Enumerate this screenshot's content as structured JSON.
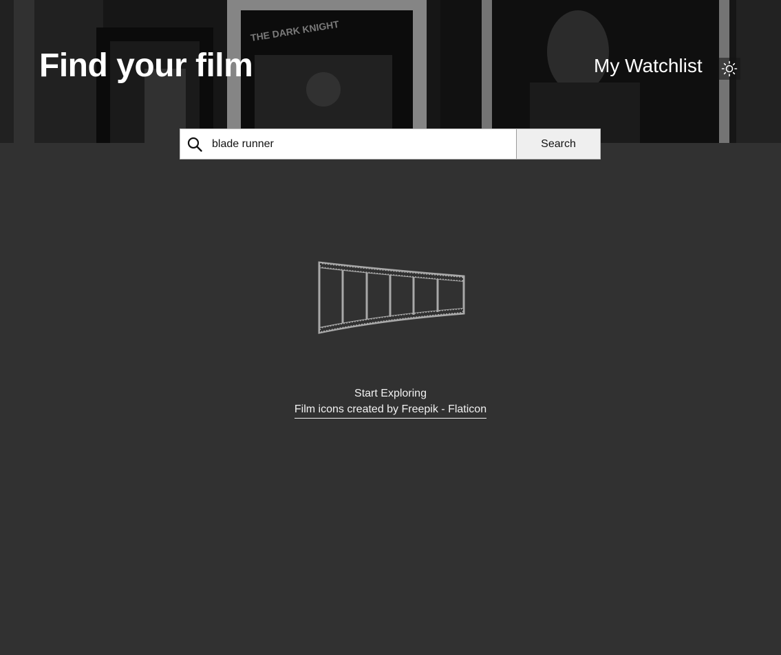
{
  "header": {
    "title": "Find your film",
    "watchlist_label": "My Watchlist",
    "theme_toggle_icon": "sun-icon",
    "background_poster_text": "THE DARK KNIGHT"
  },
  "search": {
    "value": "blade runner",
    "button_label": "Search",
    "icon": "search-icon"
  },
  "empty_state": {
    "icon": "film-strip-icon",
    "message": "Start Exploring",
    "credit_link": "Film icons created by Freepik - Flaticon"
  },
  "colors": {
    "page_background": "#313131",
    "text": "#ffffff",
    "icon_gray": "#a9a9a9"
  }
}
